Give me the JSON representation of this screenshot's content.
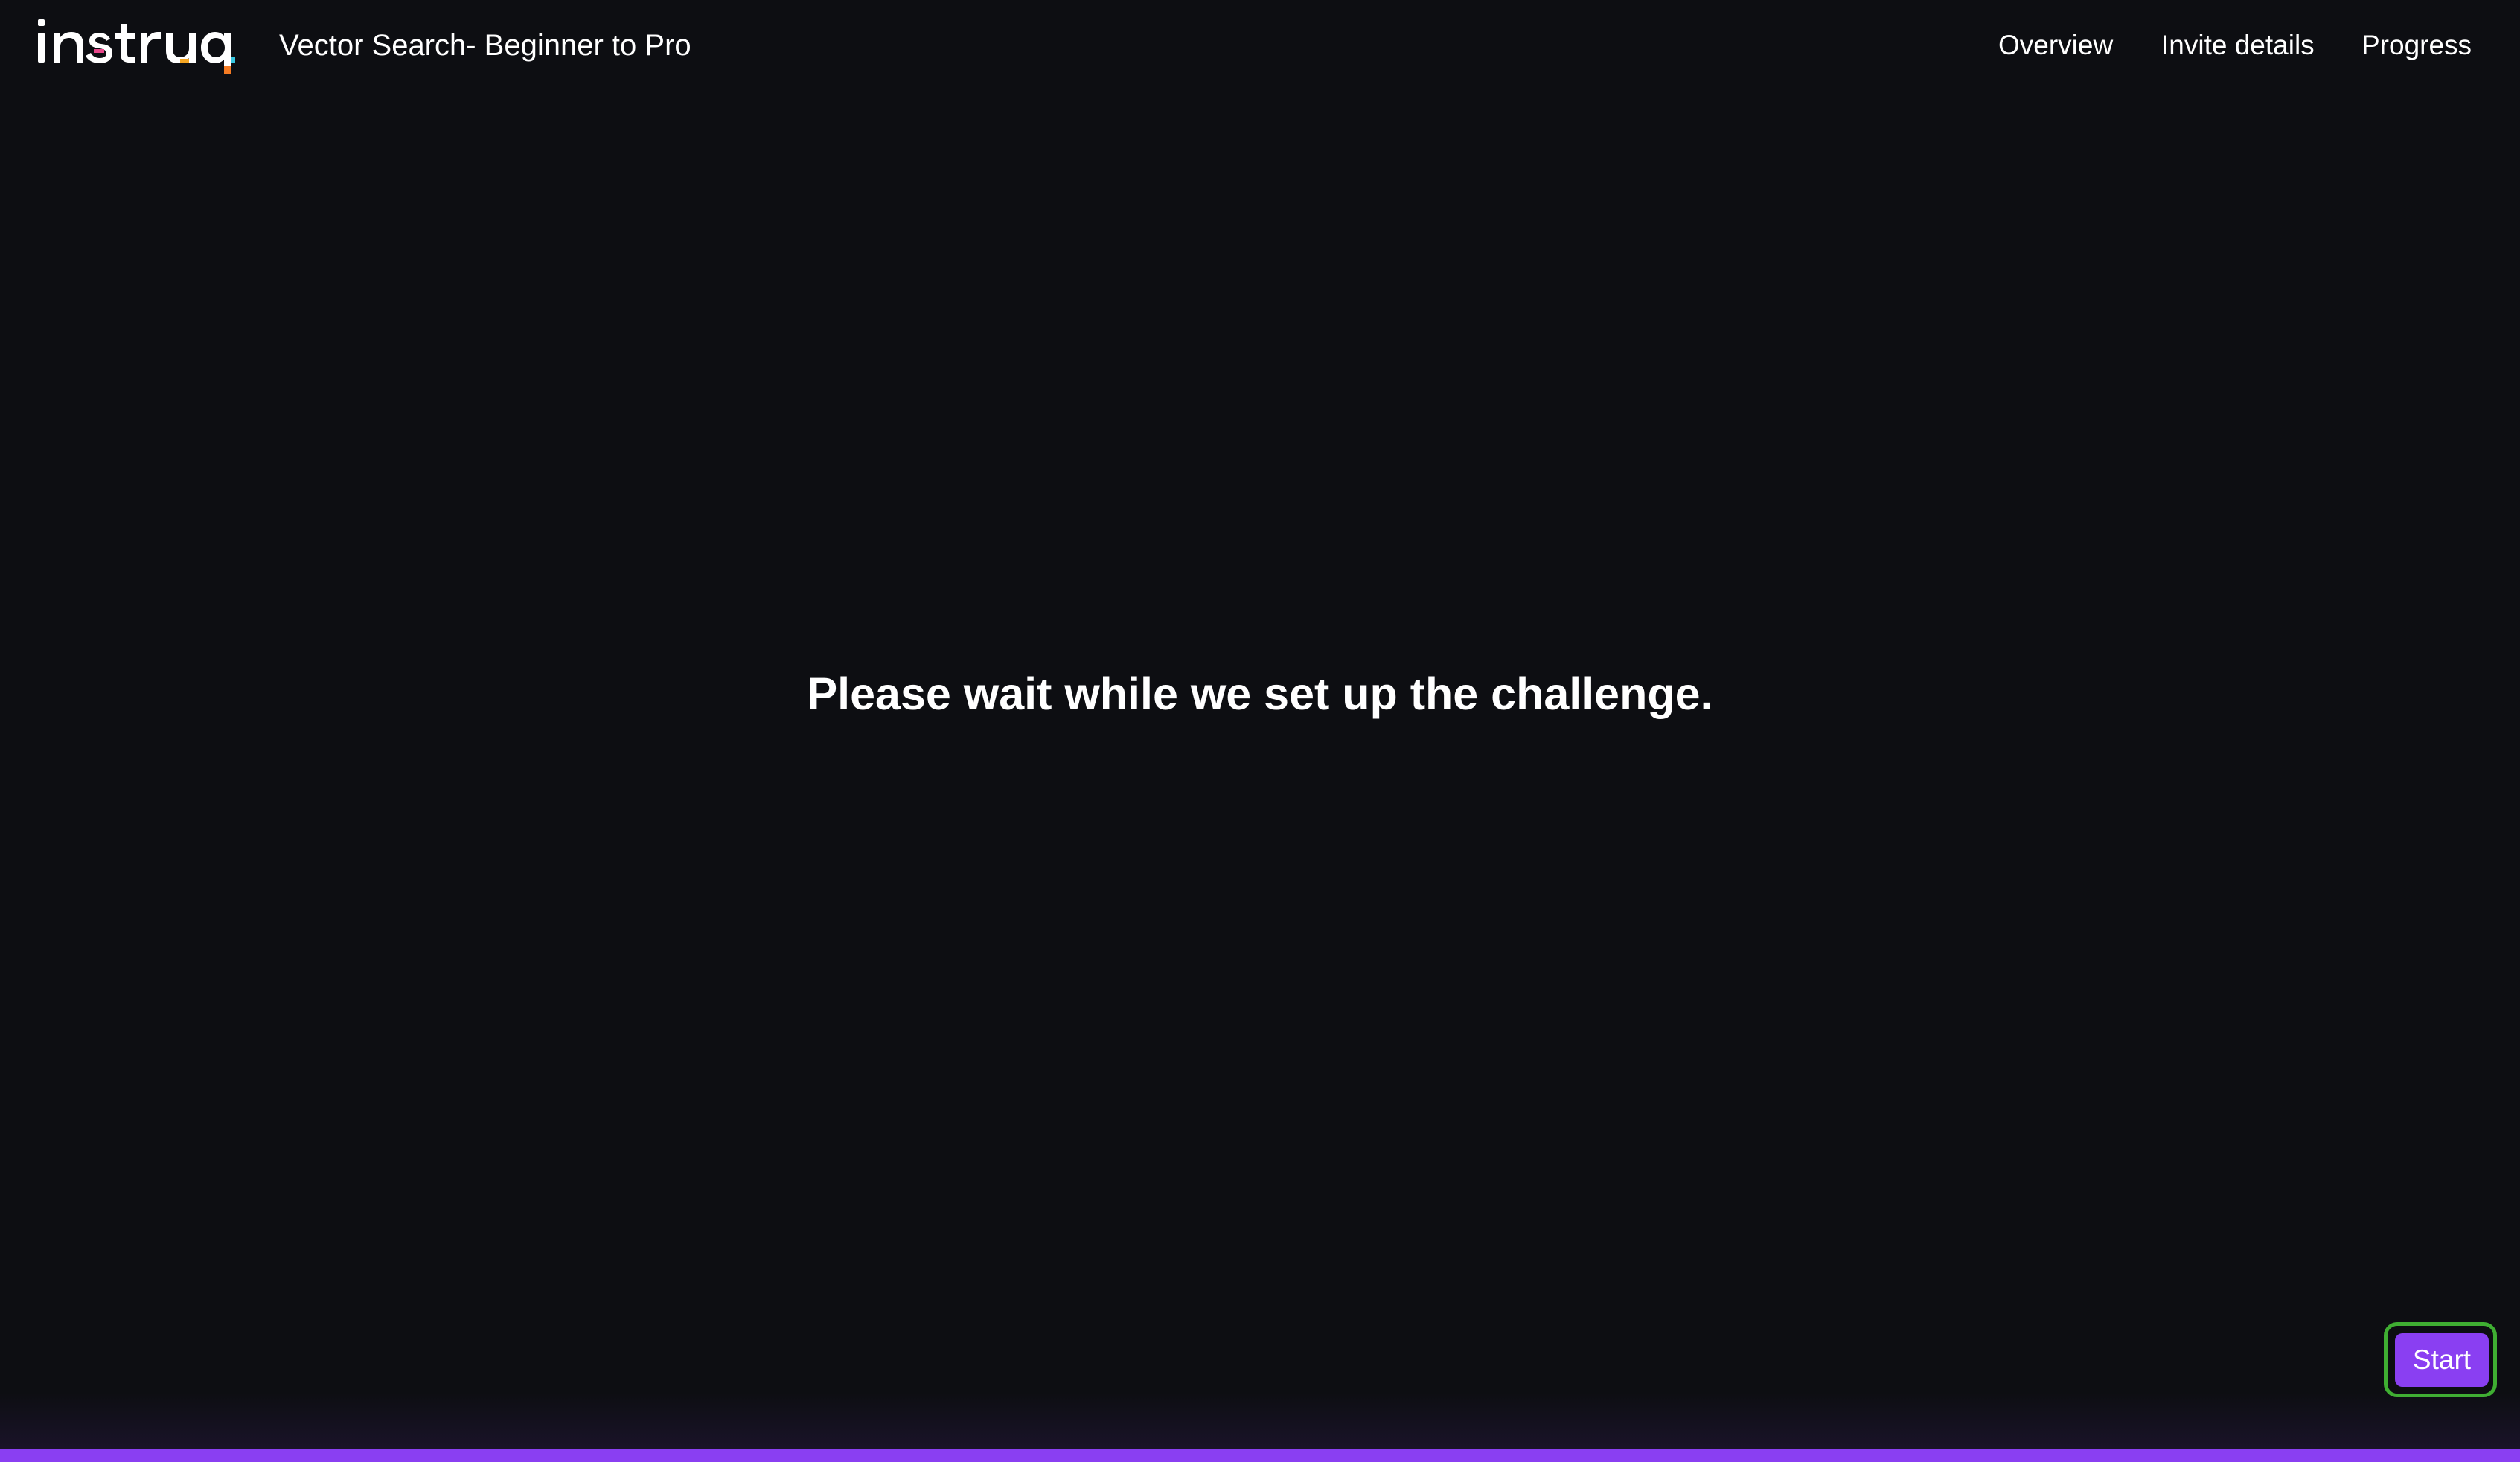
{
  "header": {
    "logo_text": "instruqt",
    "course_title": "Vector Search- Beginner to Pro",
    "nav": [
      "Overview",
      "Invite details",
      "Progress"
    ]
  },
  "main": {
    "message": "Please wait while we set up the challenge."
  },
  "actions": {
    "start_label": "Start"
  },
  "loading": {
    "progress_percent": 100
  },
  "colors": {
    "background": "#0d0e12",
    "accent": "#8a3ff2",
    "focus_ring": "#3fae32",
    "text": "#ffffff"
  }
}
